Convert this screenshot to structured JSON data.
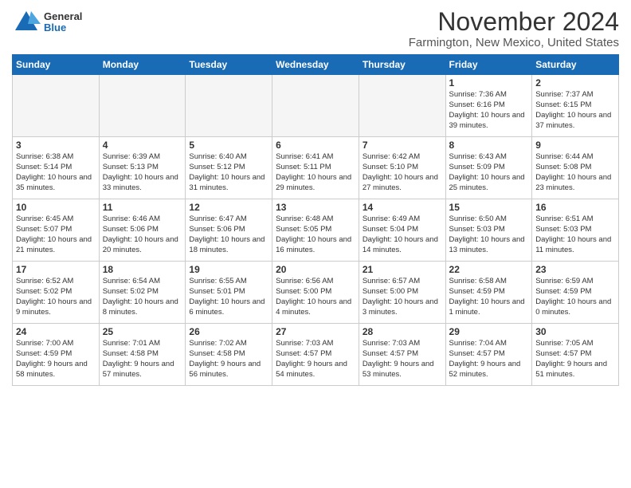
{
  "header": {
    "logo_line1": "General",
    "logo_line2": "Blue",
    "title": "November 2024",
    "subtitle": "Farmington, New Mexico, United States"
  },
  "calendar": {
    "days_of_week": [
      "Sunday",
      "Monday",
      "Tuesday",
      "Wednesday",
      "Thursday",
      "Friday",
      "Saturday"
    ],
    "weeks": [
      [
        {
          "day": "",
          "info": ""
        },
        {
          "day": "",
          "info": ""
        },
        {
          "day": "",
          "info": ""
        },
        {
          "day": "",
          "info": ""
        },
        {
          "day": "",
          "info": ""
        },
        {
          "day": "1",
          "info": "Sunrise: 7:36 AM\nSunset: 6:16 PM\nDaylight: 10 hours and 39 minutes."
        },
        {
          "day": "2",
          "info": "Sunrise: 7:37 AM\nSunset: 6:15 PM\nDaylight: 10 hours and 37 minutes."
        }
      ],
      [
        {
          "day": "3",
          "info": "Sunrise: 6:38 AM\nSunset: 5:14 PM\nDaylight: 10 hours and 35 minutes."
        },
        {
          "day": "4",
          "info": "Sunrise: 6:39 AM\nSunset: 5:13 PM\nDaylight: 10 hours and 33 minutes."
        },
        {
          "day": "5",
          "info": "Sunrise: 6:40 AM\nSunset: 5:12 PM\nDaylight: 10 hours and 31 minutes."
        },
        {
          "day": "6",
          "info": "Sunrise: 6:41 AM\nSunset: 5:11 PM\nDaylight: 10 hours and 29 minutes."
        },
        {
          "day": "7",
          "info": "Sunrise: 6:42 AM\nSunset: 5:10 PM\nDaylight: 10 hours and 27 minutes."
        },
        {
          "day": "8",
          "info": "Sunrise: 6:43 AM\nSunset: 5:09 PM\nDaylight: 10 hours and 25 minutes."
        },
        {
          "day": "9",
          "info": "Sunrise: 6:44 AM\nSunset: 5:08 PM\nDaylight: 10 hours and 23 minutes."
        }
      ],
      [
        {
          "day": "10",
          "info": "Sunrise: 6:45 AM\nSunset: 5:07 PM\nDaylight: 10 hours and 21 minutes."
        },
        {
          "day": "11",
          "info": "Sunrise: 6:46 AM\nSunset: 5:06 PM\nDaylight: 10 hours and 20 minutes."
        },
        {
          "day": "12",
          "info": "Sunrise: 6:47 AM\nSunset: 5:06 PM\nDaylight: 10 hours and 18 minutes."
        },
        {
          "day": "13",
          "info": "Sunrise: 6:48 AM\nSunset: 5:05 PM\nDaylight: 10 hours and 16 minutes."
        },
        {
          "day": "14",
          "info": "Sunrise: 6:49 AM\nSunset: 5:04 PM\nDaylight: 10 hours and 14 minutes."
        },
        {
          "day": "15",
          "info": "Sunrise: 6:50 AM\nSunset: 5:03 PM\nDaylight: 10 hours and 13 minutes."
        },
        {
          "day": "16",
          "info": "Sunrise: 6:51 AM\nSunset: 5:03 PM\nDaylight: 10 hours and 11 minutes."
        }
      ],
      [
        {
          "day": "17",
          "info": "Sunrise: 6:52 AM\nSunset: 5:02 PM\nDaylight: 10 hours and 9 minutes."
        },
        {
          "day": "18",
          "info": "Sunrise: 6:54 AM\nSunset: 5:02 PM\nDaylight: 10 hours and 8 minutes."
        },
        {
          "day": "19",
          "info": "Sunrise: 6:55 AM\nSunset: 5:01 PM\nDaylight: 10 hours and 6 minutes."
        },
        {
          "day": "20",
          "info": "Sunrise: 6:56 AM\nSunset: 5:00 PM\nDaylight: 10 hours and 4 minutes."
        },
        {
          "day": "21",
          "info": "Sunrise: 6:57 AM\nSunset: 5:00 PM\nDaylight: 10 hours and 3 minutes."
        },
        {
          "day": "22",
          "info": "Sunrise: 6:58 AM\nSunset: 4:59 PM\nDaylight: 10 hours and 1 minute."
        },
        {
          "day": "23",
          "info": "Sunrise: 6:59 AM\nSunset: 4:59 PM\nDaylight: 10 hours and 0 minutes."
        }
      ],
      [
        {
          "day": "24",
          "info": "Sunrise: 7:00 AM\nSunset: 4:59 PM\nDaylight: 9 hours and 58 minutes."
        },
        {
          "day": "25",
          "info": "Sunrise: 7:01 AM\nSunset: 4:58 PM\nDaylight: 9 hours and 57 minutes."
        },
        {
          "day": "26",
          "info": "Sunrise: 7:02 AM\nSunset: 4:58 PM\nDaylight: 9 hours and 56 minutes."
        },
        {
          "day": "27",
          "info": "Sunrise: 7:03 AM\nSunset: 4:57 PM\nDaylight: 9 hours and 54 minutes."
        },
        {
          "day": "28",
          "info": "Sunrise: 7:03 AM\nSunset: 4:57 PM\nDaylight: 9 hours and 53 minutes."
        },
        {
          "day": "29",
          "info": "Sunrise: 7:04 AM\nSunset: 4:57 PM\nDaylight: 9 hours and 52 minutes."
        },
        {
          "day": "30",
          "info": "Sunrise: 7:05 AM\nSunset: 4:57 PM\nDaylight: 9 hours and 51 minutes."
        }
      ]
    ]
  }
}
